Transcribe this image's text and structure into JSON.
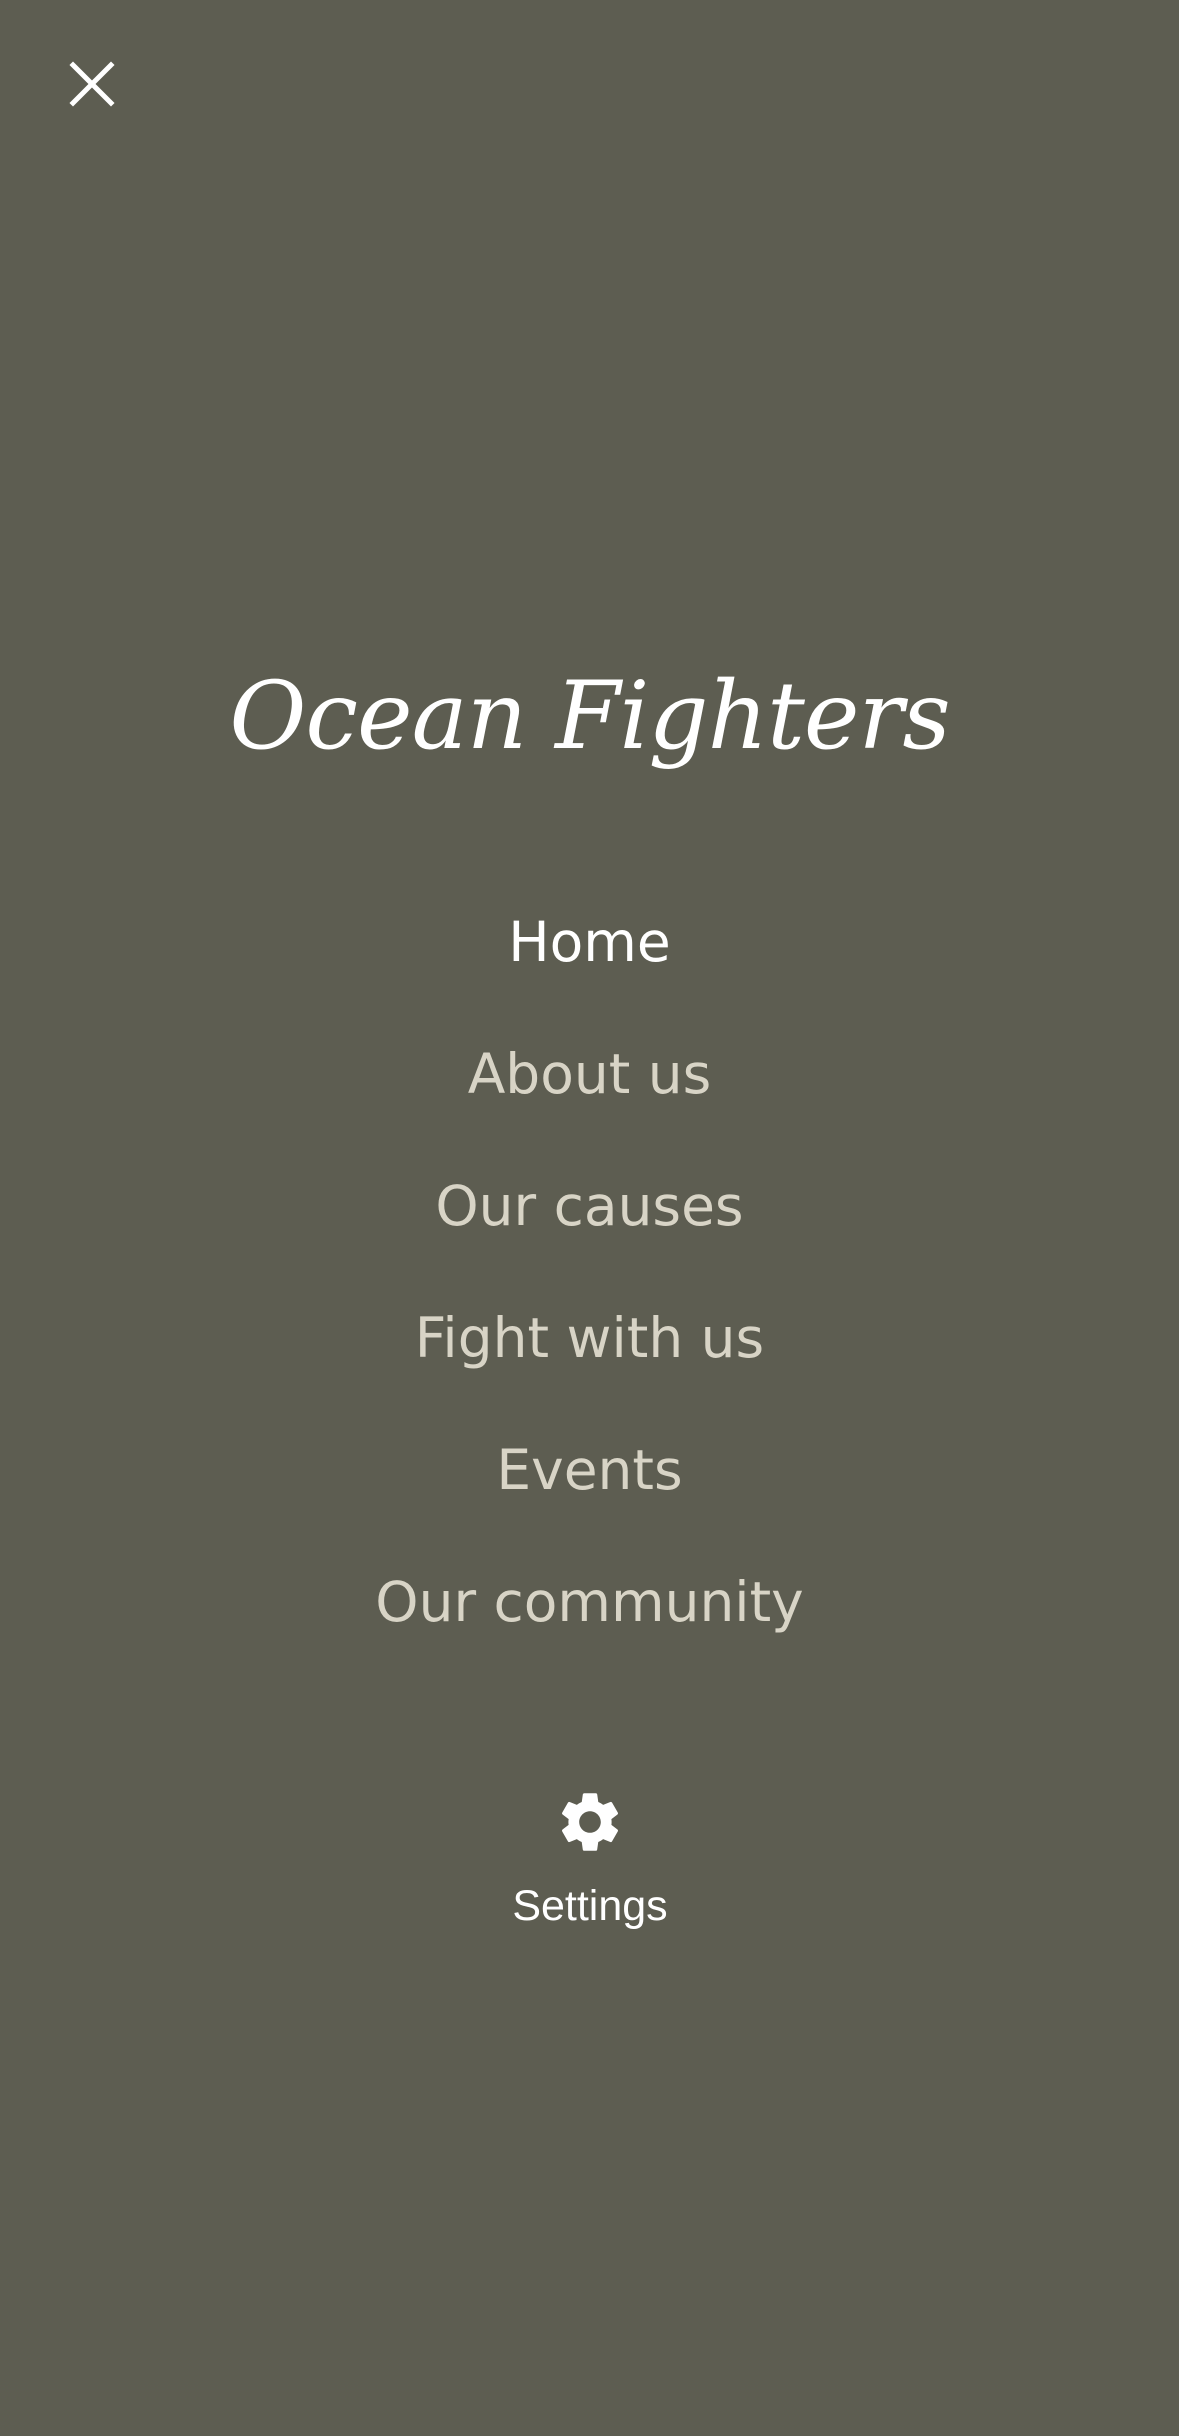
{
  "close": {
    "icon": "close-icon"
  },
  "brand": {
    "title": "Ocean Fighters"
  },
  "nav": {
    "items": [
      {
        "label": "Home",
        "active": true
      },
      {
        "label": "About us"
      },
      {
        "label": "Our causes"
      },
      {
        "label": "Fight with us"
      },
      {
        "label": "Events"
      },
      {
        "label": "Our community"
      }
    ]
  },
  "settings": {
    "icon": "gear-icon",
    "label": "Settings"
  },
  "colors": {
    "background": "#5d5d51",
    "active_text": "#ffffff",
    "inactive_text": "#d8d4c6"
  }
}
